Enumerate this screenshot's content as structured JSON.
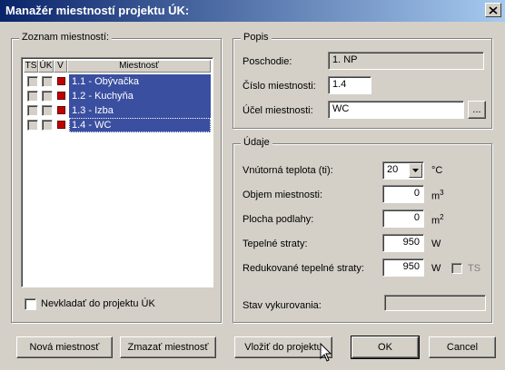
{
  "window": {
    "title": "Manažér miestností projektu ÚK:"
  },
  "room_list": {
    "group_title": "Zoznam miestností:",
    "headers": {
      "ts": "TS",
      "uk": "ÚK",
      "v": "V",
      "name": "Miestnosť"
    },
    "rooms": [
      {
        "name": "1.1 - Obývačka"
      },
      {
        "name": "1.2 - Kuchyňa"
      },
      {
        "name": "1.3 - Izba"
      },
      {
        "name": "1.4 - WC"
      }
    ],
    "exclude_label": "Nevkladať do projektu ÚK"
  },
  "popis": {
    "group_title": "Popis",
    "poschodie_label": "Poschodie:",
    "poschodie_value": "1. NP",
    "cislo_label": "Číslo miestnosti:",
    "cislo_value": "1.4",
    "ucel_label": "Účel miestnosti:",
    "ucel_value": "WC",
    "browse_label": "..."
  },
  "udaje": {
    "group_title": "Údaje",
    "teplota_label": "Vnútorná teplota (ti):",
    "teplota_value": "20",
    "teplota_unit": "°C",
    "objem_label": "Objem miestnosti:",
    "objem_value": "0",
    "objem_unit": "m",
    "objem_unit_exp": "3",
    "plocha_label": "Plocha podlahy:",
    "plocha_value": "0",
    "plocha_unit": "m",
    "plocha_unit_exp": "2",
    "straty_label": "Tepelné straty:",
    "straty_value": "950",
    "straty_unit": "W",
    "red_label": "Redukované tepelné straty:",
    "red_value": "950",
    "red_unit": "W",
    "ts_label": "TS",
    "stav_label": "Stav vykurovania:",
    "stav_value": ""
  },
  "buttons": {
    "new": "Nová miestnosť",
    "delete": "Zmazať miestnosť",
    "insert": "Vložiť do projektu",
    "ok": "OK",
    "cancel": "Cancel"
  },
  "colors": {
    "selection": "#3a4fa0",
    "title_start": "#0a246a",
    "marker_red": "#c00000"
  }
}
